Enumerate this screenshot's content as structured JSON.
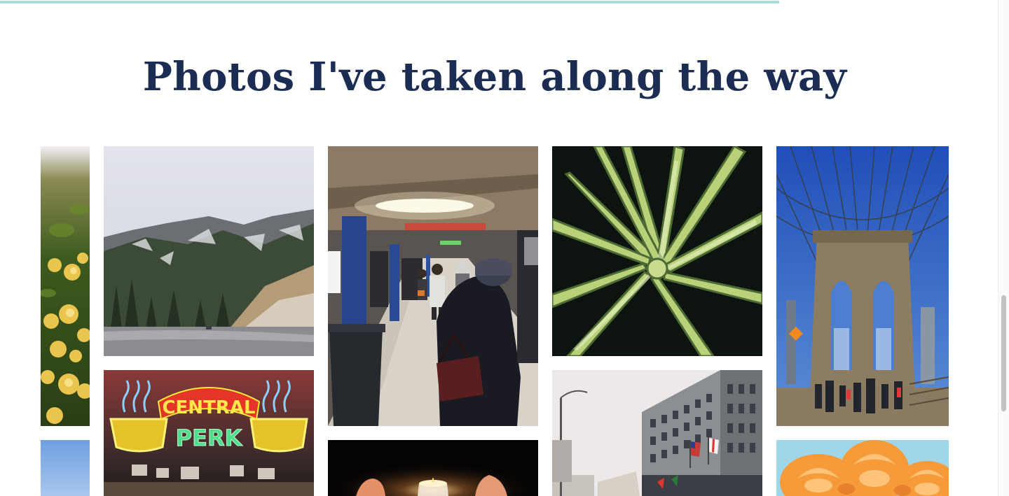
{
  "page": {
    "title": "Photos I've taken along the way",
    "scroll_progress": 0.78
  },
  "gallery": {
    "photos": [
      {
        "name": "photo-yellow-flowers",
        "alt": "yellow flowers"
      },
      {
        "name": "photo-snowy-mountain",
        "alt": "snowy mountain road"
      },
      {
        "name": "photo-subway-platform",
        "alt": "subway platform"
      },
      {
        "name": "photo-agave-plant",
        "alt": "agave plant"
      },
      {
        "name": "photo-brooklyn-bridge",
        "alt": "Brooklyn Bridge"
      },
      {
        "name": "photo-blue-sky",
        "alt": "blue sky"
      },
      {
        "name": "photo-central-perk-sign",
        "alt": "Central Perk neon sign"
      },
      {
        "name": "photo-candle-hands",
        "alt": "hands around a candle"
      },
      {
        "name": "photo-city-building",
        "alt": "city building with flags"
      },
      {
        "name": "photo-orange-roses",
        "alt": "orange roses"
      }
    ],
    "neon_sign": {
      "line1": "CENTRAL",
      "line2": "PERK"
    }
  },
  "colors": {
    "title": "#1b2d52",
    "progress": "#a8dcda"
  }
}
